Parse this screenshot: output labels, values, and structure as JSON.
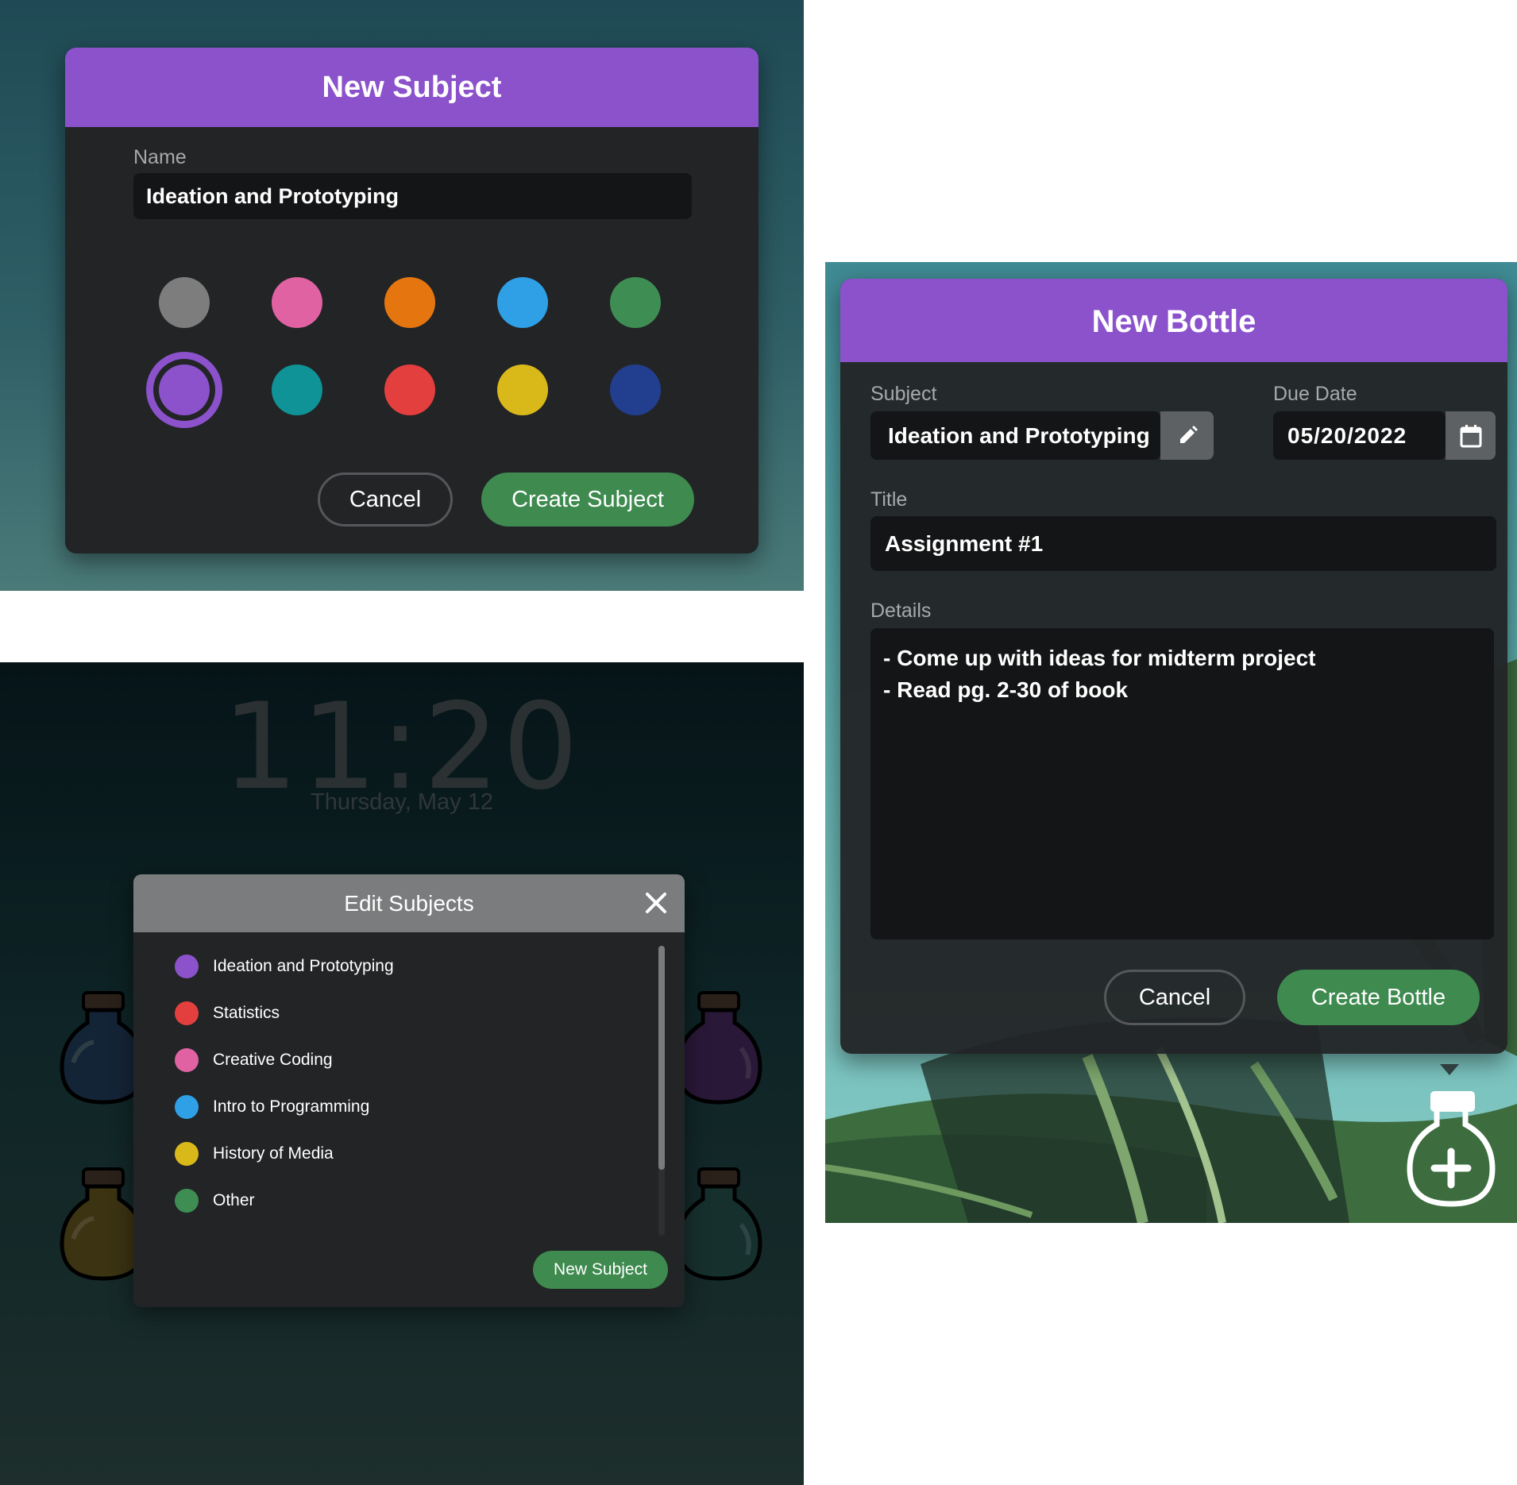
{
  "new_subject": {
    "title": "New Subject",
    "name_label": "Name",
    "name_value": "Ideation and Prototyping",
    "colors": [
      "#7d7d7d",
      "#e062a2",
      "#e5760f",
      "#2f9fe6",
      "#3e8e54",
      "#8b52cc",
      "#0f9396",
      "#e33f3f",
      "#d9b91a",
      "#223f8f"
    ],
    "selected_color": "#8b52cc",
    "cancel_label": "Cancel",
    "create_label": "Create Subject"
  },
  "lock_screen": {
    "time": "11:20",
    "date": "Thursday, May 12"
  },
  "edit_subjects": {
    "title": "Edit Subjects",
    "close_icon": "close-icon",
    "subjects": [
      {
        "label": "Ideation and Prototyping",
        "color": "#8b52cc"
      },
      {
        "label": "Statistics",
        "color": "#e33f3f"
      },
      {
        "label": "Creative Coding",
        "color": "#e062a2"
      },
      {
        "label": "Intro to Programming",
        "color": "#2f9fe6"
      },
      {
        "label": "History of Media",
        "color": "#d9b91a"
      },
      {
        "label": "Other",
        "color": "#3e8e54"
      }
    ],
    "new_subject_label": "New Subject"
  },
  "new_bottle": {
    "title": "New Bottle",
    "subject_label": "Subject",
    "subject_value": "Ideation and Prototyping",
    "due_date_label": "Due Date",
    "due_date_value": "05/20/2022",
    "title_label": "Title",
    "title_value": "Assignment #1",
    "details_label": "Details",
    "details_lines": [
      "- Come up with ideas for midterm project",
      "- Read pg. 2-30 of book"
    ],
    "cancel_label": "Cancel",
    "create_label": "Create Bottle",
    "add_bottle_icon": "add-bottle-icon"
  }
}
